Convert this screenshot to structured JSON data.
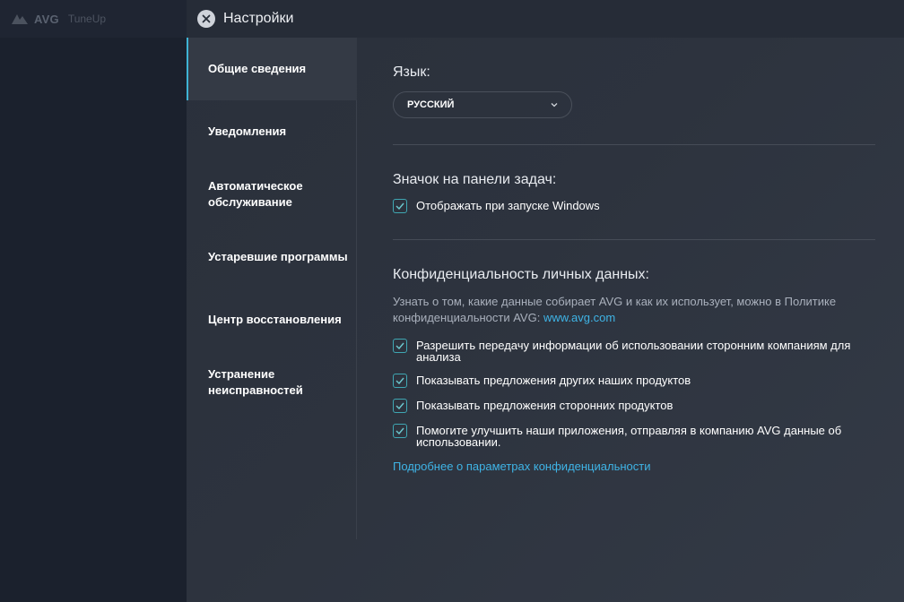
{
  "app": {
    "brand": "AVG",
    "product": "TuneUp"
  },
  "dialog": {
    "title": "Настройки"
  },
  "nav": {
    "items": [
      {
        "label": "Общие сведения",
        "active": true
      },
      {
        "label": "Уведомления",
        "active": false
      },
      {
        "label": "Автоматическое обслуживание",
        "active": false
      },
      {
        "label": "Устаревшие программы",
        "active": false
      },
      {
        "label": "Центр восстановления",
        "active": false
      },
      {
        "label": "Устранение неисправностей",
        "active": false
      }
    ]
  },
  "language": {
    "title": "Язык:",
    "selected": "РУССКИЙ"
  },
  "tray": {
    "title": "Значок на панели задач:",
    "options": [
      {
        "label": "Отображать при запуске Windows",
        "checked": true
      }
    ]
  },
  "privacy": {
    "title": "Конфиденциальность личных данных:",
    "description": "Узнать о том, какие данные собирает AVG и как их использует, можно в Политике конфиденциальности AVG: ",
    "description_link": "www.avg.com",
    "options": [
      {
        "label": "Разрешить передачу информации об использовании сторонним компаниям для анализа",
        "checked": true
      },
      {
        "label": "Показывать предложения других наших продуктов",
        "checked": true
      },
      {
        "label": "Показывать предложения сторонних продуктов",
        "checked": true
      },
      {
        "label": "Помогите улучшить наши приложения, отправляя в компанию AVG данные об использовании.",
        "checked": true
      }
    ],
    "more_link": "Подробнее о параметрах конфиденциальности"
  },
  "colors": {
    "accent": "#3fb4d5",
    "checkbox": "#3fa7b3",
    "link": "#3fb4e6"
  }
}
